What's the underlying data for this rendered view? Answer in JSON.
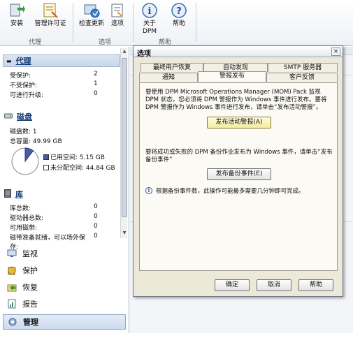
{
  "ribbon": {
    "buttons": [
      {
        "label": "安装",
        "icon": "install-icon"
      },
      {
        "label": "管理许可证",
        "icon": "license-icon"
      },
      {
        "label": "检查更新",
        "icon": "check-updates-icon"
      },
      {
        "label": "选项",
        "icon": "options-icon"
      },
      {
        "label": "关于\nDPM",
        "icon": "info-icon"
      },
      {
        "label": "帮助",
        "icon": "help-icon"
      }
    ],
    "groups": [
      "代理",
      "选项",
      "帮助"
    ]
  },
  "left": {
    "agents": {
      "title": "代理",
      "rows": [
        {
          "label": "受保护:",
          "value": "2"
        },
        {
          "label": "不受保护:",
          "value": "1"
        },
        {
          "label": "可进行升级:",
          "value": "0"
        }
      ]
    },
    "disks": {
      "title": "磁盘",
      "count_label": "磁盘数:  1",
      "total_label": "总容量:  49.99 GB",
      "used_label": "已用空间: 5.15 GB",
      "free_label": "未分配空间: 44.84 GB",
      "used_fraction": 0.103,
      "colors": {
        "used": "#4a5ba8",
        "free": "#ffffff"
      }
    },
    "libraries": {
      "title": "库",
      "rows": [
        {
          "label": "库总数:",
          "value": "0"
        },
        {
          "label": "驱动器总数:",
          "value": "0"
        },
        {
          "label": "可用磁带:",
          "value": "0"
        },
        {
          "label": "磁带准备就绪，可以场外保存:",
          "value": "0"
        }
      ]
    },
    "nav": [
      {
        "label": "监视",
        "icon": "monitor-icon"
      },
      {
        "label": "保护",
        "icon": "protection-icon"
      },
      {
        "label": "恢复",
        "icon": "recovery-icon"
      },
      {
        "label": "报告",
        "icon": "reports-icon"
      },
      {
        "label": "管理",
        "icon": "management-icon",
        "selected": true
      }
    ]
  },
  "dialog": {
    "title": "选项",
    "close": "×",
    "tabs_row1": [
      "最终用户恢复",
      "自动发现",
      "SMTP 服务器"
    ],
    "tabs_row2": [
      "通知",
      "警报发布",
      "客户反馈"
    ],
    "active_tab": "警报发布",
    "alert_text": "要使用 DPM Microsoft Operations Manager (MOM) Pack 监视 DPM 状态，您必须将 DPM 警报作为 Windows 事件进行发布。要将 DPM 警报作为 Windows 事件进行发布，请单击“发布活动警报”。",
    "publish_alerts_btn": "发布活动警报(A)",
    "backup_text": "要将成功或失败的 DPM 备份作业发布为 Windows 事件，请单击“发布备份事件”",
    "publish_backup_btn": "发布备份事件(E)",
    "info_text": "根据备份事件数，此操作可能最多需要几分钟即可完成。",
    "ok": "确定",
    "cancel": "取消",
    "help": "帮助"
  }
}
